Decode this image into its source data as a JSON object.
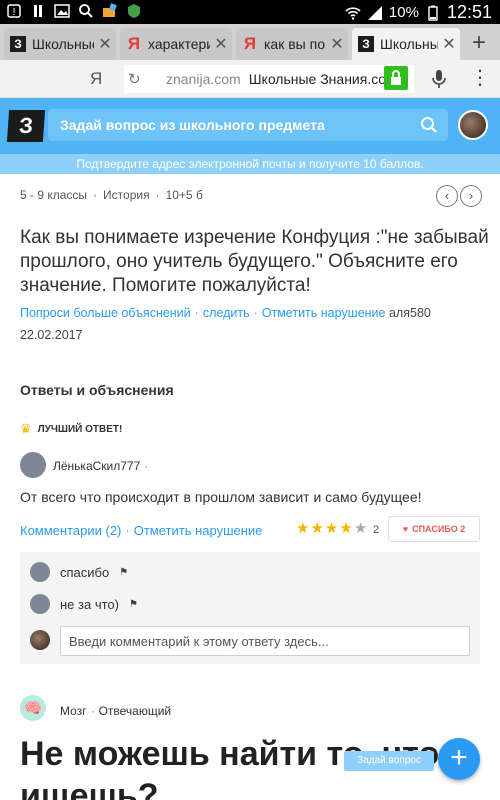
{
  "status_bar": {
    "battery": "10%",
    "time": "12:51"
  },
  "tabs": [
    {
      "favicon": "znanija-logo",
      "label": "Школьные",
      "active": false
    },
    {
      "favicon": "yandex-logo",
      "label": "характери",
      "active": false
    },
    {
      "favicon": "yandex-logo",
      "label": "как вы пон",
      "active": false
    },
    {
      "favicon": "znanija-logo",
      "label": "Школьные",
      "active": true
    }
  ],
  "address_bar": {
    "yandex_label": "Я",
    "domain": "znanija.com",
    "page_title": "Школьные Знания.com"
  },
  "header": {
    "logo": "З",
    "search_placeholder": "Задай вопрос из школьного предмета"
  },
  "notice": "Подтвердите адрес электронной почты и получите 10 баллов.",
  "question": {
    "grade": "5 - 9 классы",
    "subject": "История",
    "points": "10+5 б",
    "text": "Как вы понимаете изречение Конфуция :\"не забывай прошлого, оно учитель будущего.\" Объясните его значение. Помогите пожалуйста!",
    "actions": [
      "Попроси больше объяснений",
      "следить",
      "Отметить нарушение"
    ],
    "author": "аля580",
    "date": "22.02.2017"
  },
  "answers_section": {
    "title": "Ответы и объяснения",
    "best_label": "ЛУЧШИЙ ОТВЕТ!"
  },
  "answer": {
    "author": "ЛёнькаСкил777",
    "text": "От всего что происходит в прошлом зависит и само будущее!",
    "comments_link": "Комментарии (2)",
    "report_link": "Отметить нарушение",
    "rating": 4,
    "rating_count": "2",
    "thanks_label": "СПАСИБО 2"
  },
  "comments": [
    {
      "text": "спасибо"
    },
    {
      "text": "не за что)"
    }
  ],
  "comment_input_placeholder": "Введи комментарий к этому ответу здесь...",
  "answer2": {
    "author": "Мозг",
    "role": "Отвечающий"
  },
  "promo_heading": "Не можешь найти то, что ищешь?",
  "fab_label": "Задай вопрос",
  "colors": {
    "brand_blue": "#4fb3f6",
    "link_blue": "#2b9af3",
    "star_gold": "#f6b400",
    "lock_green": "#2fbf1f"
  }
}
